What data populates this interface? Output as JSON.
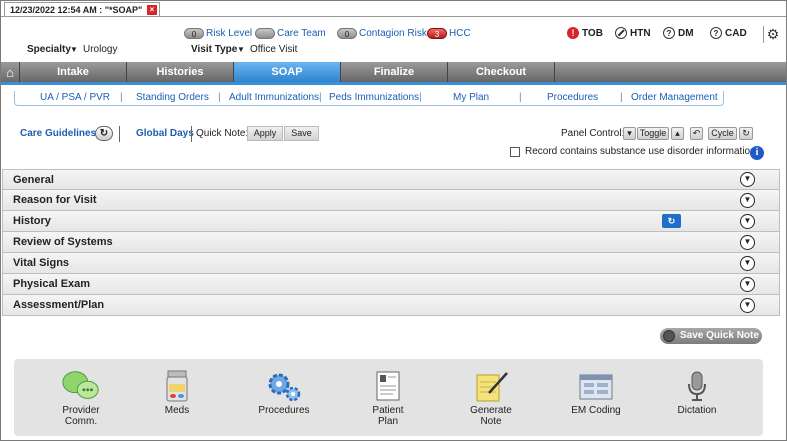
{
  "document_tab": {
    "title": "12/23/2022 12:54 AM : \"*SOAP\"",
    "close": "×"
  },
  "risk": {
    "risk_level_count": "0",
    "risk_level_label": "Risk Level",
    "care_team_label": "Care Team",
    "contagion_count": "0",
    "contagion_label": "Contagion Risk",
    "hcc_count": "3",
    "hcc_label": "HCC"
  },
  "conditions": [
    {
      "label": "TOB",
      "icon": "alert-icon",
      "glyph": "!"
    },
    {
      "label": "HTN",
      "icon": "no-entry-icon",
      "glyph": ""
    },
    {
      "label": "DM",
      "icon": "question-icon",
      "glyph": "?"
    },
    {
      "label": "CAD",
      "icon": "question-icon",
      "glyph": "?"
    }
  ],
  "specialty": {
    "label": "Specialty",
    "value": "Urology"
  },
  "visit_type": {
    "label": "Visit Type",
    "value": "Office Visit"
  },
  "main_tabs": [
    "Intake",
    "Histories",
    "SOAP",
    "Finalize",
    "Checkout"
  ],
  "active_main_tab": "SOAP",
  "sub_tabs": [
    "UA / PSA / PVR",
    "Standing Orders",
    "Adult Immunizations",
    "Peds Immunizations",
    "My Plan",
    "Procedures",
    "Order Management"
  ],
  "toolbar": {
    "care_guidelines": "Care Guidelines",
    "global_days": "Global Days",
    "quick_note_label": "Quick Note:",
    "apply": "Apply",
    "save": "Save",
    "panel_control": "Panel Control:",
    "toggle": "Toggle",
    "cycle": "Cycle"
  },
  "substance_label": "Record contains substance use disorder information",
  "sections": [
    "General",
    "Reason for Visit",
    "History",
    "Review of Systems",
    "Vital Signs",
    "Physical Exam",
    "Assessment/Plan"
  ],
  "save_quick_note": "Save Quick Note",
  "tray": [
    {
      "line1": "Provider",
      "line2": "Comm.",
      "icon": "provider-comm-icon"
    },
    {
      "line1": "Meds",
      "line2": "",
      "icon": "meds-icon"
    },
    {
      "line1": "Procedures",
      "line2": "",
      "icon": "procedures-icon"
    },
    {
      "line1": "Patient",
      "line2": "Plan",
      "icon": "patient-plan-icon"
    },
    {
      "line1": "Generate",
      "line2": "Note",
      "icon": "generate-note-icon"
    },
    {
      "line1": "EM Coding",
      "line2": "",
      "icon": "em-coding-icon"
    },
    {
      "line1": "Dictation",
      "line2": "",
      "icon": "dictation-icon"
    }
  ],
  "colors": {
    "accent": "#2f83cf",
    "link": "#1a5fb4",
    "tab_gray": "#7a7a7a",
    "alert_red": "#d9242b"
  }
}
